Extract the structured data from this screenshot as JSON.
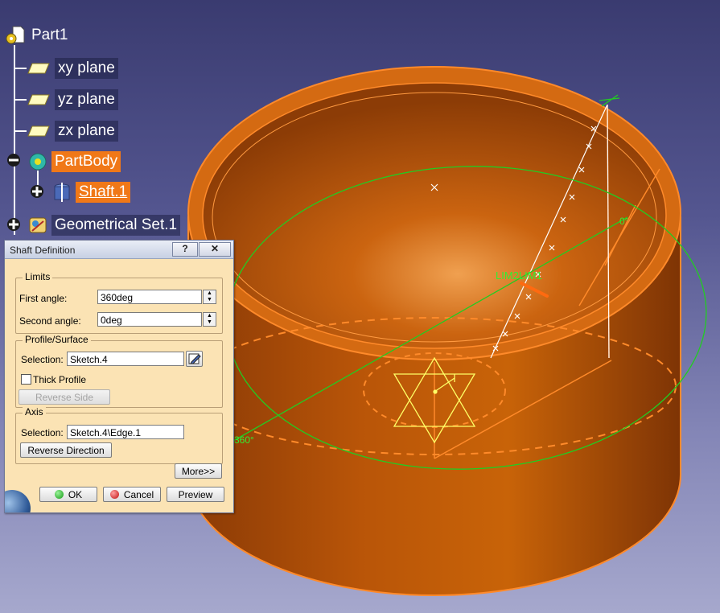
{
  "tree": {
    "root_label": "Part1",
    "items": [
      {
        "label": "xy plane",
        "icon": "plane-icon"
      },
      {
        "label": "yz plane",
        "icon": "plane-icon"
      },
      {
        "label": "zx plane",
        "icon": "plane-icon"
      },
      {
        "label": "PartBody",
        "icon": "body-icon"
      },
      {
        "label": "Shaft.1",
        "icon": "shaft-icon"
      },
      {
        "label": "Geometrical Set.1",
        "icon": "geometrical-set-icon"
      }
    ]
  },
  "viewport": {
    "annotation_limits": "LIM2LIM1",
    "angle_label_top": "0°",
    "angle_label_left": "360°",
    "colors": {
      "solid": "#c25a08",
      "edge": "#ff8a2a",
      "sketch": "#ffff66",
      "construction": "#22cc22"
    }
  },
  "dialog": {
    "title": "Shaft Definition",
    "help_button": "?",
    "close_button": "✕",
    "limits": {
      "legend": "Limits",
      "first_angle_label": "First angle:",
      "first_angle_value": "360deg",
      "second_angle_label": "Second angle:",
      "second_angle_value": "0deg"
    },
    "profile": {
      "legend": "Profile/Surface",
      "selection_label": "Selection:",
      "selection_value": "Sketch.4",
      "thick_profile_label": "Thick Profile",
      "thick_profile_checked": false,
      "reverse_side_label": "Reverse Side"
    },
    "axis": {
      "legend": "Axis",
      "selection_label": "Selection:",
      "selection_value": "Sketch.4\\Edge.1",
      "reverse_direction_label": "Reverse Direction"
    },
    "more_label": "More>>",
    "ok_label": "OK",
    "cancel_label": "Cancel",
    "preview_label": "Preview"
  }
}
